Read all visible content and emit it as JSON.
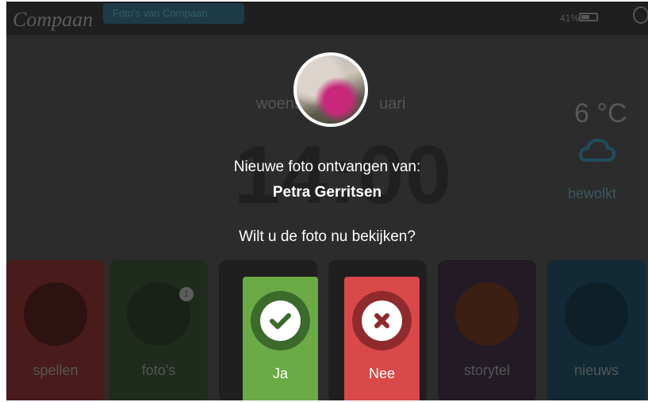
{
  "statusbar": {
    "app_name": "Compaan",
    "pill_text": "Foto's van Compaan",
    "battery_percent": "41%"
  },
  "home": {
    "date_part_1": "woens",
    "date_part_2": "uari",
    "clock": "14:00",
    "weather": {
      "temperature": "6 °C",
      "description": "bewolkt",
      "icon": "cloud-icon"
    },
    "tiles": [
      {
        "label": "spellen",
        "color": "#4a1b1b"
      },
      {
        "label": "foto's",
        "color": "#1f2b1d",
        "badge": "1"
      },
      {
        "label": "",
        "color": "#1f1f1f"
      },
      {
        "label": "",
        "color": "#1f1f1f"
      },
      {
        "label": "storytel",
        "color": "#221b26"
      },
      {
        "label": "nieuws",
        "color": "#112a35"
      }
    ]
  },
  "dialog": {
    "message": "Nieuwe foto ontvangen van:",
    "sender": "Petra Gerritsen",
    "question": "Wilt u de foto nu bekijken?",
    "yes_label": "Ja",
    "no_label": "Nee",
    "colors": {
      "yes": "#6bab46",
      "no": "#d9494a"
    }
  }
}
